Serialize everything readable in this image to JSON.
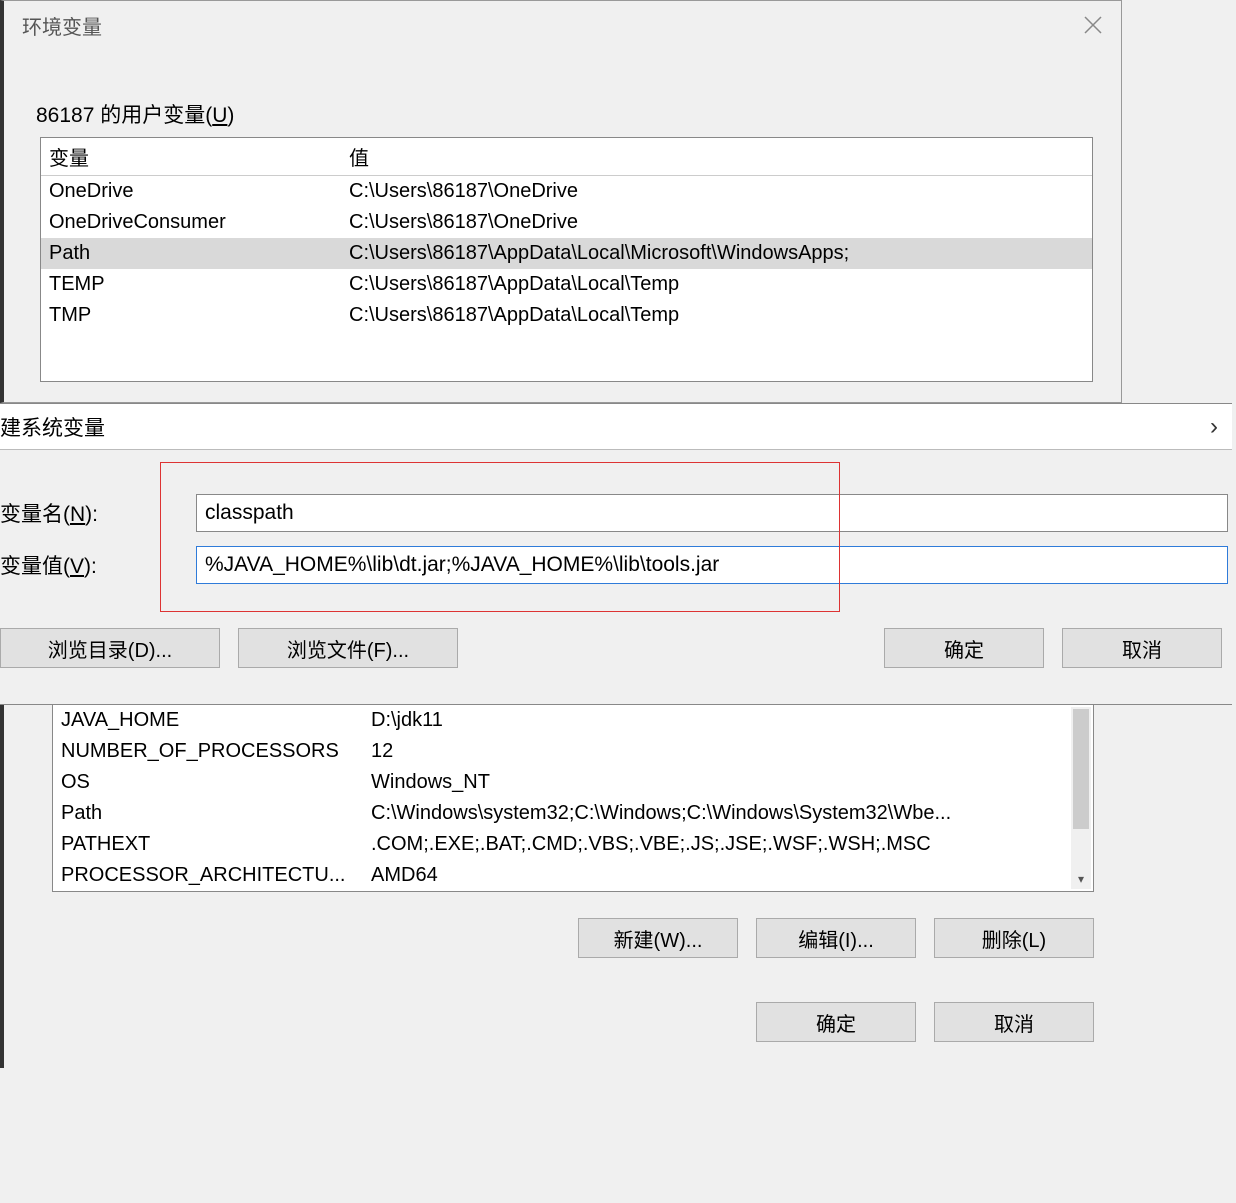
{
  "main": {
    "title": "环境变量",
    "user_group_label_prefix": "86187 的用户变量(",
    "user_group_label_key": "U",
    "user_group_label_suffix": ")",
    "columns": {
      "var": "变量",
      "val": "值"
    },
    "user_vars": [
      {
        "name": "OneDrive",
        "value": "C:\\Users\\86187\\OneDrive",
        "selected": false
      },
      {
        "name": "OneDriveConsumer",
        "value": "C:\\Users\\86187\\OneDrive",
        "selected": false
      },
      {
        "name": "Path",
        "value": "C:\\Users\\86187\\AppData\\Local\\Microsoft\\WindowsApps;",
        "selected": true
      },
      {
        "name": "TEMP",
        "value": "C:\\Users\\86187\\AppData\\Local\\Temp",
        "selected": false
      },
      {
        "name": "TMP",
        "value": "C:\\Users\\86187\\AppData\\Local\\Temp",
        "selected": false
      }
    ]
  },
  "subdialog": {
    "title": "建系统变量",
    "name_label_prefix": "变量名(",
    "name_label_key": "N",
    "name_label_suffix": "):",
    "value_label_prefix": "变量值(",
    "value_label_key": "V",
    "value_label_suffix": "):",
    "name_value": "classpath",
    "value_value": "%JAVA_HOME%\\lib\\dt.jar;%JAVA_HOME%\\lib\\tools.jar",
    "browse_dir": "浏览目录(D)...",
    "browse_file": "浏览文件(F)...",
    "ok": "确定",
    "cancel": "取消"
  },
  "sys": {
    "vars": [
      {
        "name": "JAVA_HOME",
        "value": "D:\\jdk11"
      },
      {
        "name": "NUMBER_OF_PROCESSORS",
        "value": "12"
      },
      {
        "name": "OS",
        "value": "Windows_NT"
      },
      {
        "name": "Path",
        "value": "C:\\Windows\\system32;C:\\Windows;C:\\Windows\\System32\\Wbe..."
      },
      {
        "name": "PATHEXT",
        "value": ".COM;.EXE;.BAT;.CMD;.VBS;.VBE;.JS;.JSE;.WSF;.WSH;.MSC"
      },
      {
        "name": "PROCESSOR_ARCHITECTU...",
        "value": "AMD64"
      }
    ],
    "new_btn": "新建(W)...",
    "edit_btn": "编辑(I)...",
    "delete_btn": "删除(L)",
    "ok": "确定",
    "cancel": "取消"
  }
}
